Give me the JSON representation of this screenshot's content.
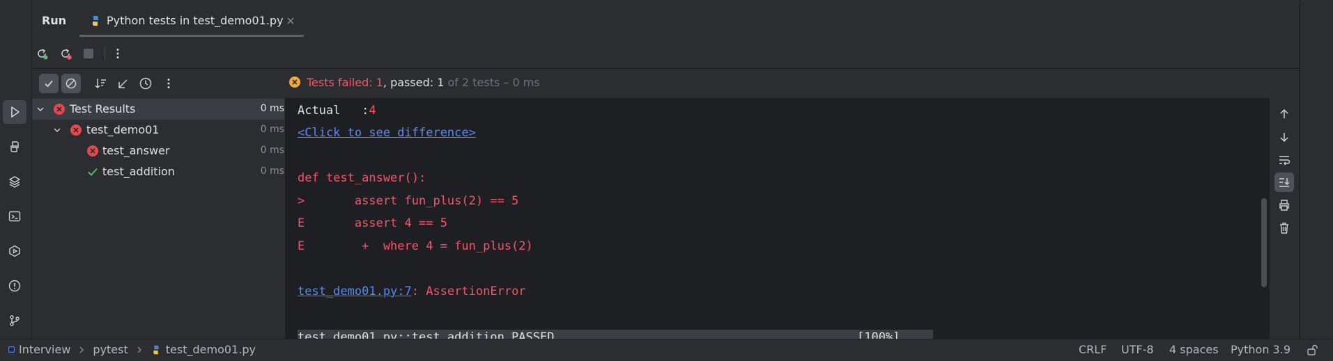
{
  "run_tabs": {
    "run_label": "Run",
    "test_tab_label": "Python tests in test_demo01.py"
  },
  "status": {
    "failed_text": "Tests failed: 1",
    "comma": ", ",
    "passed_text": "passed: 1",
    "rest_text": " of 2 tests – 0 ms"
  },
  "tree": {
    "root": {
      "label": "Test Results",
      "time": "0 ms"
    },
    "module": {
      "label": "test_demo01",
      "time": "0 ms"
    },
    "items": [
      {
        "label": "test_answer",
        "time": "0 ms",
        "status": "failed"
      },
      {
        "label": "test_addition",
        "time": "0 ms",
        "status": "passed"
      }
    ]
  },
  "console": {
    "actual_label": "Actual   :",
    "actual_value": "4",
    "diff_link": "<Click to see difference>",
    "code_lines": [
      "def test_answer():",
      ">       assert fun_plus(2) == 5",
      "E       assert 4 == 5",
      "E        +  where 4 = fun_plus(2)"
    ],
    "error_link": "test_demo01.py:7",
    "error_sep": ": ",
    "error_text": "AssertionError",
    "passed_line": "test_demo01.py::test_addition PASSED",
    "progress": "[100%]"
  },
  "breadcrumb": {
    "project": "Interview",
    "folder": "pytest",
    "file": "test_demo01.py"
  },
  "statusbar": {
    "line_ending": "CRLF",
    "encoding": "UTF-8",
    "indent": "4 spaces",
    "interpreter": "Python 3.9"
  },
  "colors": {
    "background": "#1e1f22",
    "panel": "#2b2d30",
    "error": "#f75464",
    "success": "#5fb865",
    "link": "#548af7",
    "warning": "#f2a93b"
  }
}
